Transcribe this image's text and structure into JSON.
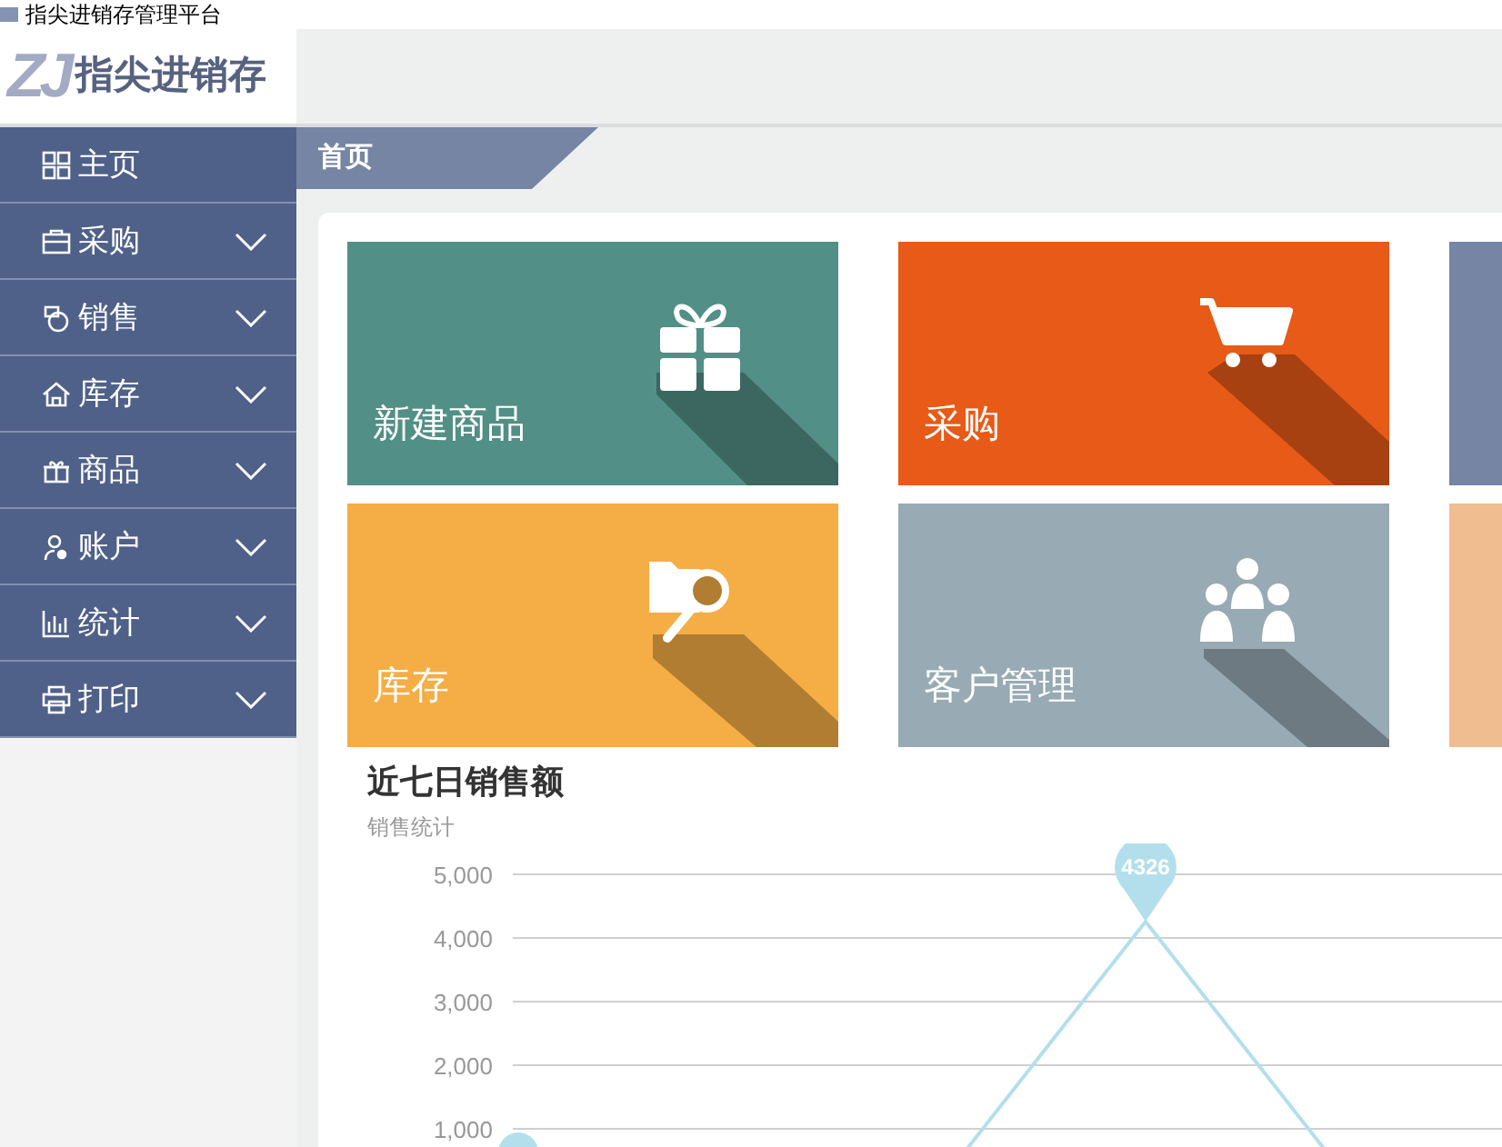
{
  "window": {
    "title": "指尖进销存管理平台"
  },
  "logo": {
    "mark": "ZJ",
    "name": "指尖进销存"
  },
  "sidebar": {
    "items": [
      {
        "label": "主页",
        "kind": "link"
      },
      {
        "label": "采购",
        "kind": "menu"
      },
      {
        "label": "销售",
        "kind": "menu"
      },
      {
        "label": "库存",
        "kind": "menu"
      },
      {
        "label": "商品",
        "kind": "menu"
      },
      {
        "label": "账户",
        "kind": "menu"
      },
      {
        "label": "统计",
        "kind": "menu"
      },
      {
        "label": "打印",
        "kind": "menu"
      }
    ]
  },
  "tabs": [
    {
      "label": "首页",
      "selected": true
    }
  ],
  "tiles": [
    {
      "label": "新建商品",
      "color": "#528f86"
    },
    {
      "label": "采购",
      "color": "#e85a17"
    },
    {
      "color": "#7585a3"
    },
    {
      "label": "库存",
      "color": "#f5ad45"
    },
    {
      "label": "客户管理",
      "color": "#98aab4"
    },
    {
      "color": "#efbd8f"
    }
  ],
  "sales": {
    "title": "近七日销售额",
    "subtitle": "销售统计",
    "axis_labels": [
      "5,000",
      "4,000",
      "3,000",
      "2,000",
      "1,000"
    ],
    "peak_label": "4326"
  }
}
